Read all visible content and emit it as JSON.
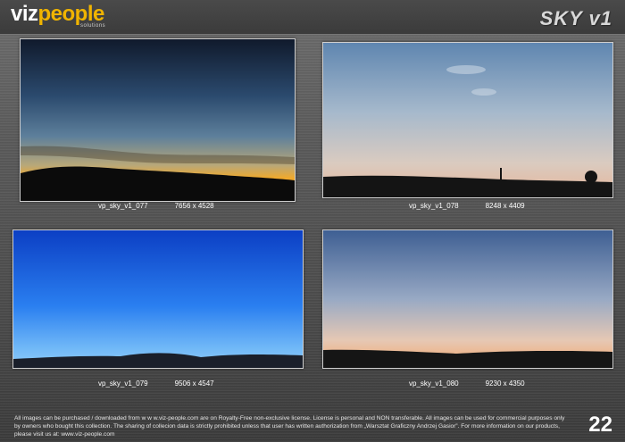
{
  "header": {
    "logo_viz": "viz",
    "logo_people": "people",
    "logo_sub": "solutions",
    "collection_title": "SKY v1"
  },
  "images": [
    {
      "name": "vp_sky_v1_077",
      "size": "7656 x 4528"
    },
    {
      "name": "vp_sky_v1_078",
      "size": "8248 x 4409"
    },
    {
      "name": "vp_sky_v1_079",
      "size": "9506 x 4547"
    },
    {
      "name": "vp_sky_v1_080",
      "size": "9230 x 4350"
    }
  ],
  "footer": {
    "license_text": "All images can be purchased / downloaded from w w w.viz-people.com are on Royalty-Free non-exclusive license. License is personal and NON transferable. All images can be used for commercial purposes only by owners who bought this collection. The sharing of collecion data is strictly prohibited unless that user has written authorization from „Warsztat Graficzny Andrzej Gasior”. For more information on our products, please visit us at: www.viz-people.com",
    "page_number": "22"
  },
  "colors": {
    "brand_accent": "#f0b400",
    "background": "#555555"
  }
}
